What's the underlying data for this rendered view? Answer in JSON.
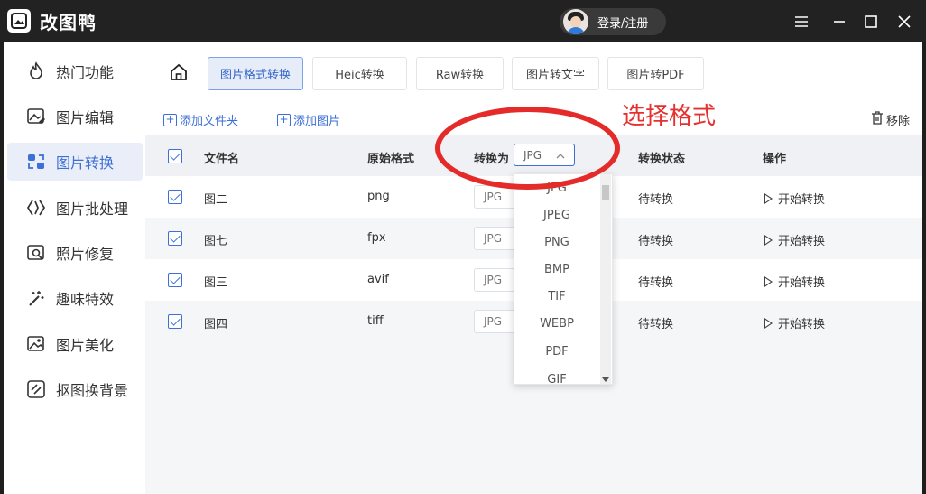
{
  "app": {
    "title": "改图鸭",
    "login_label": "登录/注册"
  },
  "sidebar": {
    "items": [
      {
        "label": "热门功能",
        "icon": "fire-icon"
      },
      {
        "label": "图片编辑",
        "icon": "image-edit-icon"
      },
      {
        "label": "图片转换",
        "icon": "image-convert-icon",
        "active": true
      },
      {
        "label": "图片批处理",
        "icon": "batch-icon"
      },
      {
        "label": "照片修复",
        "icon": "photo-repair-icon"
      },
      {
        "label": "趣味特效",
        "icon": "magic-wand-icon"
      },
      {
        "label": "图片美化",
        "icon": "image-beautify-icon"
      },
      {
        "label": "抠图换背景",
        "icon": "cutout-icon"
      }
    ]
  },
  "tabs": [
    {
      "label": "图片格式转换",
      "active": true
    },
    {
      "label": "Heic转换"
    },
    {
      "label": "Raw转换"
    },
    {
      "label": "图片转文字"
    },
    {
      "label": "图片转PDF"
    }
  ],
  "toolbar": {
    "add_folder": "添加文件夹",
    "add_image": "添加图片",
    "remove": "移除"
  },
  "annotation": {
    "text": "选择格式",
    "color": "#e53030"
  },
  "table": {
    "headers": {
      "filename": "文件名",
      "original": "原始格式",
      "convert_to": "转换为",
      "status": "转换状态",
      "action": "操作"
    },
    "header_select_value": "JPG",
    "rows": [
      {
        "name": "图二",
        "format": "png",
        "target": "JPG",
        "status": "待转换",
        "action": "开始转换"
      },
      {
        "name": "图七",
        "format": "fpx",
        "target": "JPG",
        "status": "待转换",
        "action": "开始转换"
      },
      {
        "name": "图三",
        "format": "avif",
        "target": "JPG",
        "status": "待转换",
        "action": "开始转换"
      },
      {
        "name": "图四",
        "format": "tiff",
        "target": "JPG",
        "status": "待转换",
        "action": "开始转换"
      }
    ]
  },
  "dropdown": {
    "options": [
      "JPG",
      "JPEG",
      "PNG",
      "BMP",
      "TIF",
      "WEBP",
      "PDF",
      "GIF"
    ]
  },
  "colors": {
    "accent": "#3d6fd6",
    "titlebar": "#222222"
  }
}
